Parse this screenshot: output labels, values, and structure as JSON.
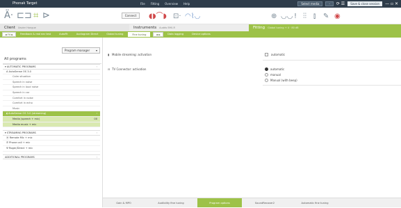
{
  "app": {
    "title": "Phonak Target"
  },
  "menu": [
    "File",
    "Fitting",
    "Overview",
    "Help"
  ],
  "titlebar": {
    "selector": "Select media",
    "selector2": "-",
    "save_close": "Save & close session",
    "window_controls": "— ▫ ✕"
  },
  "toolbar": {
    "connect": "Connect",
    "icons": [
      "earpiece-icon",
      "hearing-aid-icon",
      "audiogram-icon",
      "fitting-icon"
    ],
    "right_icons": [
      "connection-icon",
      "fitting-assistant-icon",
      "info-icon",
      "equalizer-icon",
      "chart-icon",
      "tools-icon",
      "target-icon"
    ]
  },
  "headers": {
    "client": "Client",
    "client_sub": "Xavier Hongue",
    "instruments": "Instruments",
    "instruments_sub": "Audéo B90-R",
    "fitting": "Fitting",
    "fitting_sub": "Global tuning + 4 · 80 dB"
  },
  "tabs": [
    "Feedback & real ear test",
    "AutoFit",
    "Audiogram Direct",
    "Global tuning",
    "Fine tuning",
    "Data logging",
    "Device options"
  ],
  "tab_nav": "◄ ►",
  "sidebar": {
    "program_manager": "Program manager",
    "title": "All programs",
    "groups": {
      "automatic": "AUTOMATIC PROGRAMS",
      "streaming": "STREAMING PROGRAMS",
      "additional": "ADDITIONAL PROGRAMS"
    },
    "automatic_items": [
      "AutoSense OS 3.0",
      "Calm situation",
      "Speech in noise",
      "Speech in loud noise",
      "Speech in car",
      "Comfort in noise",
      "Comfort in echo",
      "Music"
    ],
    "selected": "AutoSense OS 3.0 (streaming)",
    "selected_subs": [
      "Media (speech + mic)",
      "Media music + mic"
    ],
    "selected_count": "00",
    "streaming_items": [
      "Remote Mic + mic",
      "Phone call + mic",
      "Roger/Direct + mic"
    ]
  },
  "content": {
    "opt1": "Mobile streaming: activation",
    "opt1_icon": "mobile-icon",
    "opt1_value": "automatic",
    "opt2": "TV Connector: activation",
    "opt2_icon": "tv-icon",
    "opt2_choices": [
      "automatic",
      "manual",
      "Manual (with beep)"
    ],
    "opt2_selected": 0
  },
  "bottom_tabs": [
    "Gain & MPO",
    "Audibility fine tuning",
    "Program options",
    "SoundRecover2",
    "Automatic fine tuning"
  ],
  "bottom_active": 2,
  "colors": {
    "accent": "#9dc248",
    "titlebar": "#2f3d4b"
  }
}
